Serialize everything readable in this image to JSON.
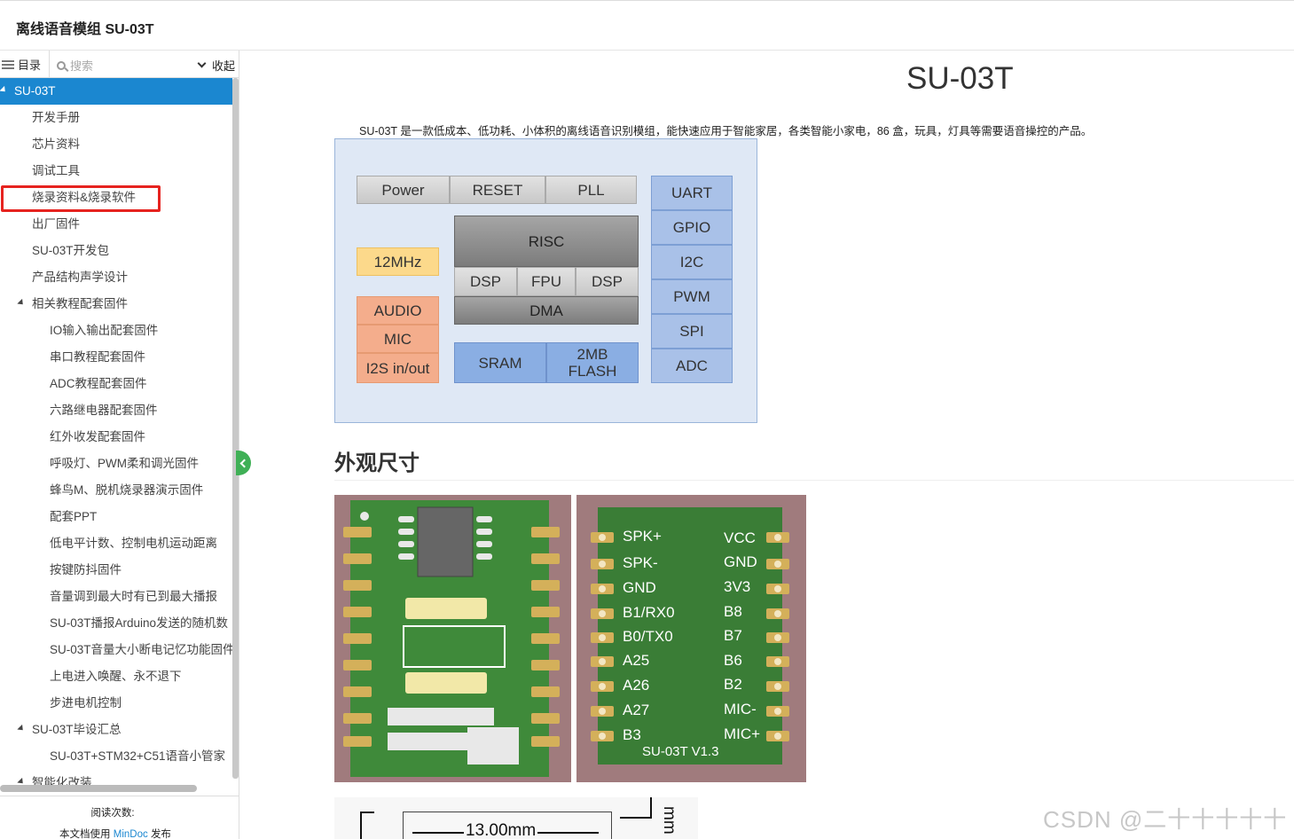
{
  "header": {
    "title": "离线语音模组 SU-03T"
  },
  "sidebar": {
    "toc_label": "目录",
    "search_placeholder": "搜索",
    "collapse_label": "收起",
    "items": [
      {
        "label": "SU-03T",
        "level": 0,
        "expanded": true,
        "active": true
      },
      {
        "label": "开发手册",
        "level": 1
      },
      {
        "label": "芯片资料",
        "level": 1
      },
      {
        "label": "调试工具",
        "level": 1
      },
      {
        "label": "烧录资料&烧录软件",
        "level": 1,
        "highlighted": true
      },
      {
        "label": "出厂固件",
        "level": 1
      },
      {
        "label": "SU-03T开发包",
        "level": 1
      },
      {
        "label": "产品结构声学设计",
        "level": 1
      },
      {
        "label": "相关教程配套固件",
        "level": 1,
        "expanded": true
      },
      {
        "label": "IO输入输出配套固件",
        "level": 2
      },
      {
        "label": "串口教程配套固件",
        "level": 2
      },
      {
        "label": "ADC教程配套固件",
        "level": 2
      },
      {
        "label": "六路继电器配套固件",
        "level": 2
      },
      {
        "label": "红外收发配套固件",
        "level": 2
      },
      {
        "label": "呼吸灯、PWM柔和调光固件",
        "level": 2
      },
      {
        "label": "蜂鸟M、脱机烧录器演示固件",
        "level": 2
      },
      {
        "label": "配套PPT",
        "level": 2
      },
      {
        "label": "低电平计数、控制电机运动距离",
        "level": 2
      },
      {
        "label": "按键防抖固件",
        "level": 2
      },
      {
        "label": "音量调到最大时有已到最大播报",
        "level": 2
      },
      {
        "label": "SU-03T播报Arduino发送的随机数",
        "level": 2
      },
      {
        "label": "SU-03T音量大小断电记忆功能固件",
        "level": 2
      },
      {
        "label": "上电进入唤醒、永不退下",
        "level": 2
      },
      {
        "label": "步进电机控制",
        "level": 2
      },
      {
        "label": "SU-03T毕设汇总",
        "level": 1,
        "expanded": true
      },
      {
        "label": "SU-03T+STM32+C51语音小管家",
        "level": 2
      },
      {
        "label": "智能化改装",
        "level": 1,
        "expanded": true
      }
    ],
    "footer": {
      "read_count_label": "阅读次数:",
      "powered_prefix": "本文档使用",
      "powered_link": "MinDoc",
      "powered_suffix": "发布"
    }
  },
  "content": {
    "title": "SU-03T",
    "intro": "SU-03T 是一款低成本、低功耗、小体积的离线语音识别模组，能快速应用于智能家居，各类智能小家电，86 盒，玩具，灯具等需要语音操控的产品。",
    "block_diagram": {
      "power": "Power",
      "reset": "RESET",
      "pll": "PLL",
      "clock": "12MHz",
      "risc": "RISC",
      "dsp1": "DSP",
      "fpu": "FPU",
      "dsp2": "DSP",
      "dma": "DMA",
      "audio": "AUDIO",
      "mic": "MIC",
      "i2s": "I2S in/out",
      "sram": "SRAM",
      "flash": "2MB FLASH",
      "uart": "UART",
      "gpio": "GPIO",
      "i2c": "I2C",
      "pwm": "PWM",
      "spi": "SPI",
      "adc": "ADC"
    },
    "section_title": "外观尺寸",
    "pinout": {
      "left": [
        "SPK+",
        "SPK-",
        "GND",
        "B1/RX0",
        "B0/TX0",
        "A25",
        "A26",
        "A27",
        "B3"
      ],
      "right": [
        "VCC",
        "GND",
        "3V3",
        "B8",
        "B7",
        "B6",
        "B2",
        "MIC-",
        "MIC+"
      ],
      "version": "SU-03T V1.3"
    },
    "dimension_label": "13.00mm",
    "dimension_unit_right": "mm"
  },
  "watermark": "CSDN @二十十十十十",
  "colors": {
    "active": "#1b87d0",
    "highlight": "#e6231f",
    "toggle": "#3fb056",
    "pcb": "#3a7d36"
  }
}
